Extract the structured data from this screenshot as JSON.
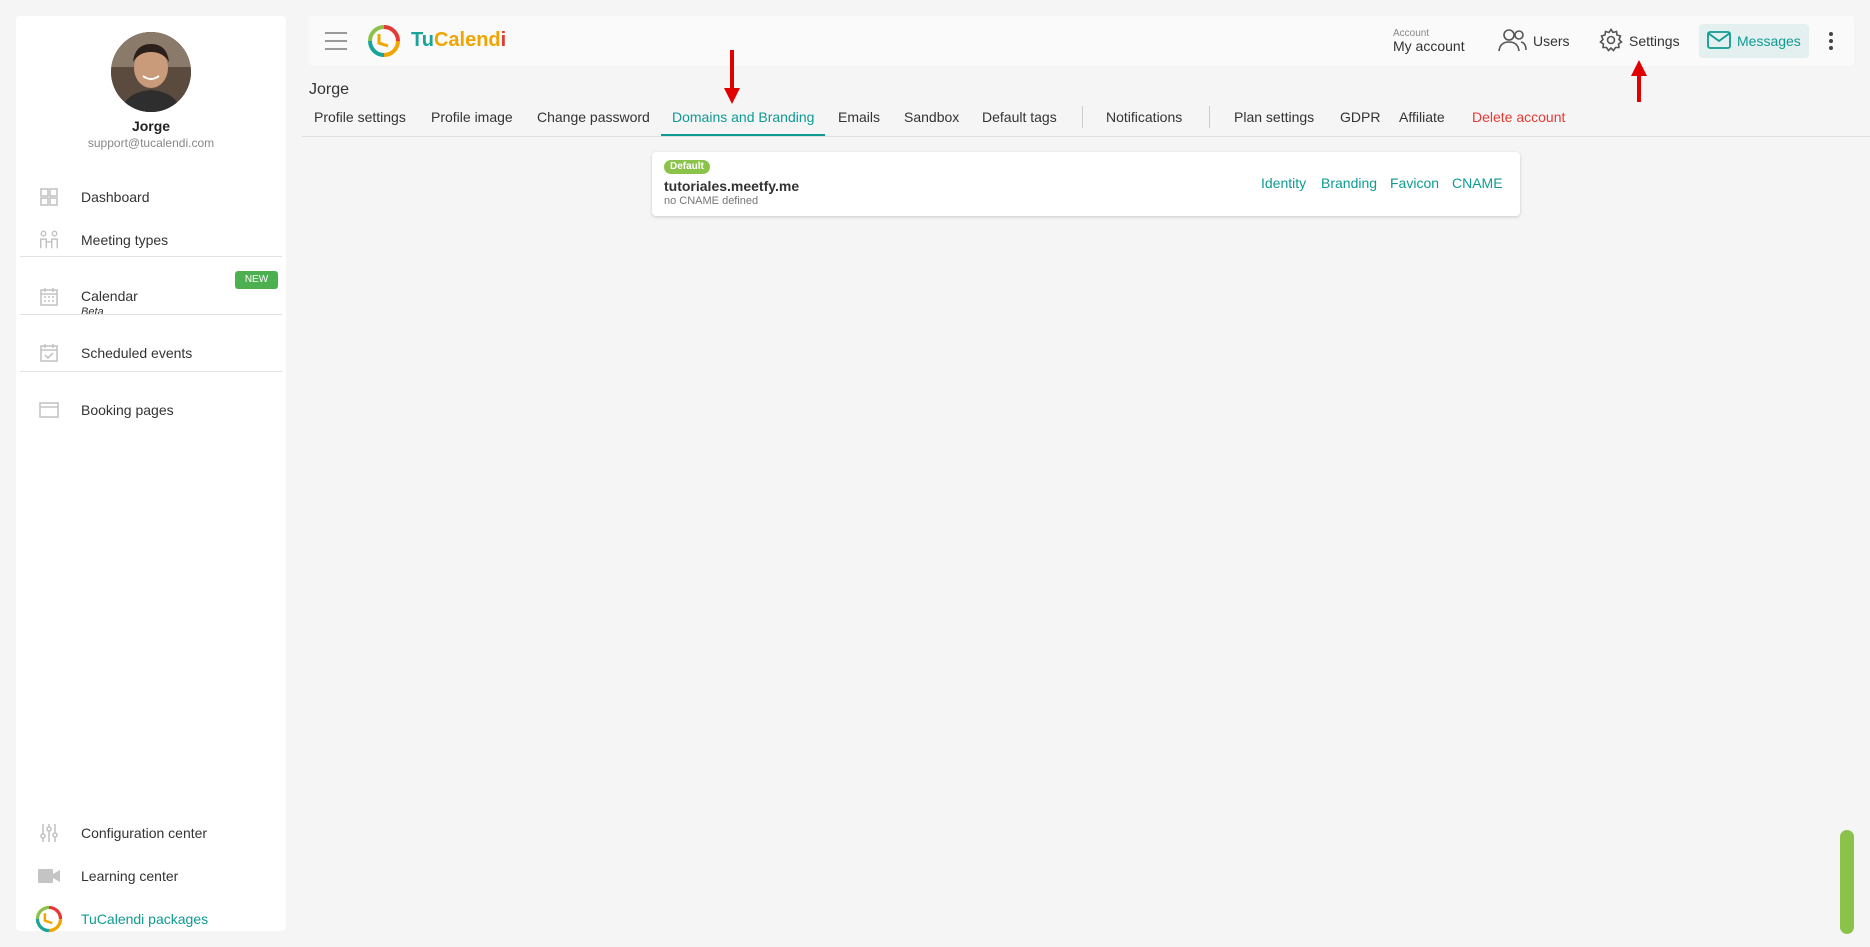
{
  "sidebar": {
    "user_name": "Jorge",
    "user_email": "support@tucalendi.com",
    "items": [
      {
        "label": "Dashboard",
        "icon": "dashboard-icon"
      },
      {
        "label": "Meeting types",
        "icon": "people-icon"
      },
      {
        "label": "Calendar",
        "sublabel": "Beta",
        "badge": "NEW",
        "icon": "calendar-icon"
      },
      {
        "label": "Scheduled events",
        "icon": "calendar-check-icon"
      },
      {
        "label": "Booking pages",
        "icon": "window-icon"
      }
    ],
    "bottom_items": [
      {
        "label": "Configuration center",
        "icon": "sliders-icon"
      },
      {
        "label": "Learning center",
        "icon": "video-icon"
      },
      {
        "label": "TuCalendi packages",
        "icon": "tucalendi-logo-icon"
      }
    ]
  },
  "topbar": {
    "logo_tu": "Tu",
    "logo_calend": "Calend",
    "logo_i": "i",
    "account_small": "Account",
    "account_label": "My account",
    "users_label": "Users",
    "settings_label": "Settings",
    "messages_label": "Messages"
  },
  "page": {
    "title": "Jorge",
    "tabs": [
      "Profile settings",
      "Profile image",
      "Change password",
      "Domains and Branding",
      "Emails",
      "Sandbox",
      "Default tags",
      "Notifications",
      "Plan settings",
      "GDPR",
      "Affiliate",
      "Delete account"
    ],
    "active_tab": "Domains and Branding"
  },
  "domain_card": {
    "badge": "Default",
    "domain": "tutoriales.meetfy.me",
    "cname_status": "no CNAME defined",
    "links": [
      "Identity",
      "Branding",
      "Favicon",
      "CNAME"
    ]
  },
  "colors": {
    "accent": "#0f9a93",
    "danger": "#e53935",
    "badge_green": "#8bc34a",
    "new_badge": "#4caf50",
    "arrow_red": "#e00000"
  }
}
